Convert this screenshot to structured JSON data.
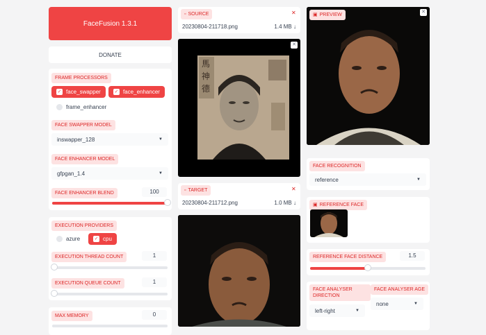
{
  "app": {
    "title": "FaceFusion 1.3.1",
    "donate_label": "DONATE"
  },
  "frame_processors": {
    "label": "FRAME PROCESSORS",
    "items": [
      {
        "label": "face_swapper",
        "checked": true
      },
      {
        "label": "face_enhancer",
        "checked": true
      },
      {
        "label": "frame_enhancer",
        "checked": false
      }
    ]
  },
  "face_swapper_model": {
    "label": "FACE SWAPPER MODEL",
    "value": "inswapper_128"
  },
  "face_enhancer_model": {
    "label": "FACE ENHANCER MODEL",
    "value": "gfpgan_1.4"
  },
  "face_enhancer_blend": {
    "label": "FACE ENHANCER BLEND",
    "value": "100",
    "fraction": 1.0
  },
  "execution_providers": {
    "label": "EXECUTION PROVIDERS",
    "items": [
      {
        "label": "azure",
        "checked": false
      },
      {
        "label": "cpu",
        "checked": true
      }
    ]
  },
  "execution_thread_count": {
    "label": "EXECUTION THREAD COUNT",
    "value": "1",
    "fraction": 0.0
  },
  "execution_queue_count": {
    "label": "EXECUTION QUEUE COUNT",
    "value": "1",
    "fraction": 0.0
  },
  "max_memory": {
    "label": "MAX MEMORY",
    "value": "0"
  },
  "source": {
    "label": "SOURCE",
    "filename": "20230804-211718.png",
    "size": "1.4 MB ↓"
  },
  "target": {
    "label": "TARGET",
    "filename": "20230804-211712.png",
    "size": "1.0 MB ↓"
  },
  "preview": {
    "label": "PREVIEW"
  },
  "face_recognition": {
    "label": "FACE RECOGNITION",
    "value": "reference"
  },
  "reference_face": {
    "label": "REFERENCE FACE"
  },
  "reference_face_distance": {
    "label": "REFERENCE FACE DISTANCE",
    "value": "1.5",
    "fraction": 0.5
  },
  "face_analyser_direction": {
    "label": "FACE ANALYSER DIRECTION",
    "value": "left-right"
  },
  "face_analyser_age": {
    "label": "FACE ANALYSER AGE",
    "value": "none"
  },
  "colors": {
    "accent": "#ef4444",
    "tag_bg": "#fde2e2",
    "tag_text": "#dc2626",
    "background": "#f4f4f5"
  }
}
